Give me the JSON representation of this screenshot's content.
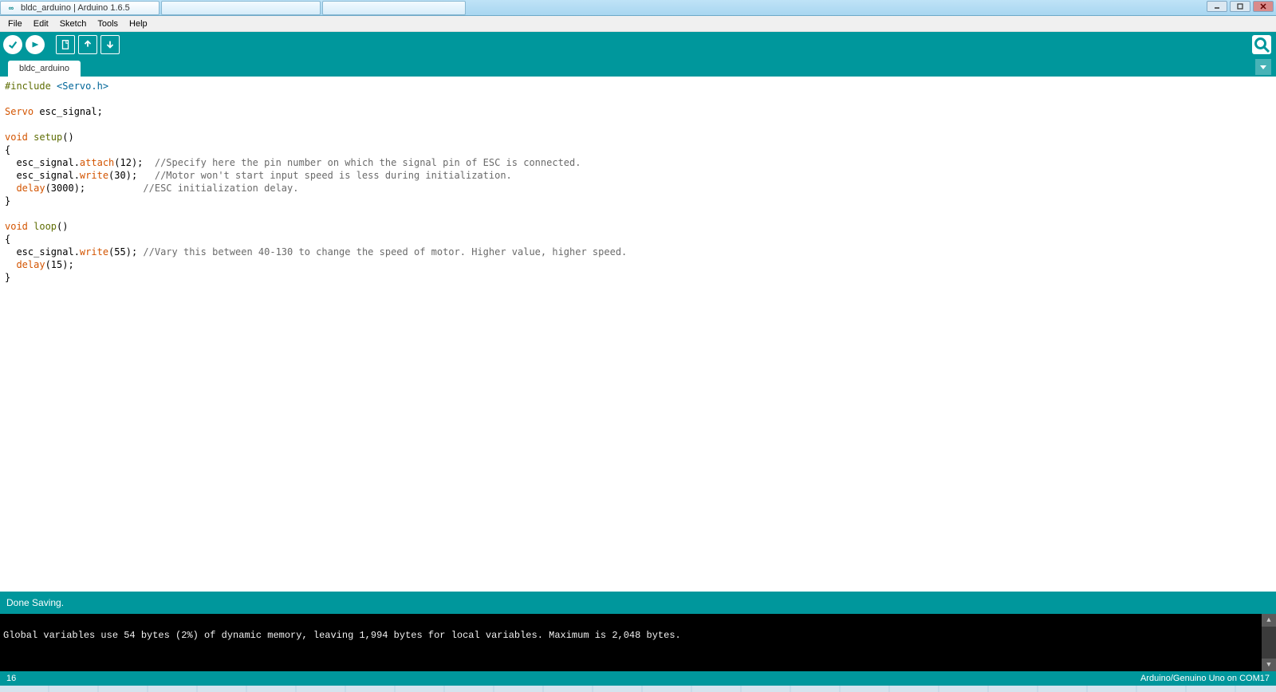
{
  "titlebar": {
    "app_title": "bldc_arduino | Arduino 1.6.5",
    "tabs": [
      {
        "label": "bldc_arduino | Arduino 1.6.5",
        "active": true
      },
      {
        "label": "",
        "active": false
      },
      {
        "label": "",
        "active": false
      }
    ]
  },
  "menubar": [
    "File",
    "Edit",
    "Sketch",
    "Tools",
    "Help"
  ],
  "toolbar": {
    "verify": "Verify",
    "upload": "Upload",
    "new": "New",
    "open": "Open",
    "save": "Save",
    "serial": "Serial Monitor"
  },
  "tabs": {
    "active": "bldc_arduino"
  },
  "code": {
    "line1_include": "#include ",
    "line1_lib": "<Servo.h>",
    "line3_type": "Servo",
    "line3_rest": " esc_signal;",
    "line5_void": "void",
    "line5_setup": " setup",
    "line5_rest": "()",
    "line6_brace": "{",
    "line7a": "  esc_signal.",
    "line7b": "attach",
    "line7c": "(12);  ",
    "line7cmt": "//Specify here the pin number on which the signal pin of ESC is connected.",
    "line8a": "  esc_signal.",
    "line8b": "write",
    "line8c": "(30);   ",
    "line8cmt": "//Motor won't start input speed is less during initialization.",
    "line9a": "  ",
    "line9b": "delay",
    "line9c": "(3000);          ",
    "line9cmt": "//ESC initialization delay.",
    "line10_brace": "}",
    "line12_void": "void",
    "line12_loop": " loop",
    "line12_rest": "()",
    "line13_brace": "{",
    "line14a": "  esc_signal.",
    "line14b": "write",
    "line14c": "(55); ",
    "line14cmt": "//Vary this between 40-130 to change the speed of motor. Higher value, higher speed.",
    "line15a": "  ",
    "line15b": "delay",
    "line15c": "(15);",
    "line16_brace": "}"
  },
  "status": {
    "message": "Done Saving."
  },
  "console": {
    "line": "Global variables use 54 bytes (2%) of dynamic memory, leaving 1,994 bytes for local variables. Maximum is 2,048 bytes."
  },
  "footer": {
    "line_no": "16",
    "board_port": "Arduino/Genuino Uno on COM17"
  }
}
